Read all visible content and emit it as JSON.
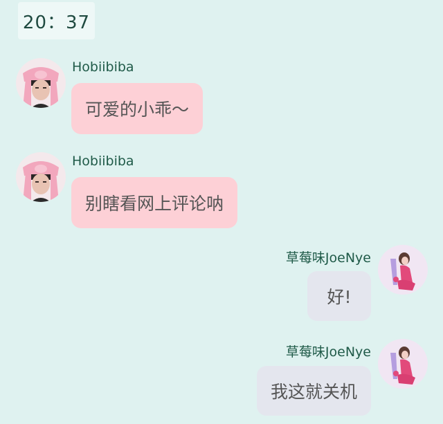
{
  "status": {
    "time": "20：37"
  },
  "messages": [
    {
      "sender": "Hobiibiba",
      "text": "可爱的小乖～",
      "side": "left"
    },
    {
      "sender": "Hobiibiba",
      "text": "别瞎看网上评论呐",
      "side": "left"
    },
    {
      "sender": "草莓味JoeNye",
      "text": "好!",
      "side": "right"
    },
    {
      "sender": "草莓味JoeNye",
      "text": "我这就关机",
      "side": "right"
    }
  ],
  "colors": {
    "background": "#dff2f0",
    "left_bubble": "#fdd0d6",
    "right_bubble": "#e4e6ee",
    "sender_name": "#1f5a48"
  }
}
